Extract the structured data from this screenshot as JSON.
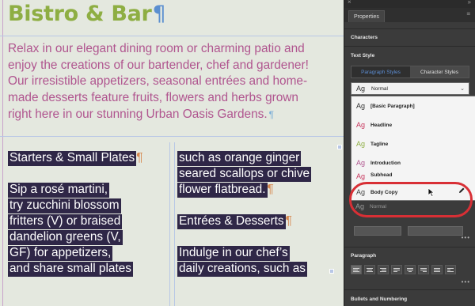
{
  "document": {
    "headline": "Bistro & Bar",
    "intro_lines": [
      "Relax in our elegant dining room or charming patio and",
      "enjoy the creations of our bartender, chef and gardener!",
      "Our irresistible appetizers, seasonal entrées and home-",
      "made desserts feature fruits, flowers and herbs grown",
      "right here in our stunning Urban Oasis Gardens."
    ],
    "column1": [
      "Starters & Small Plates",
      "",
      "Sip a rosé martini,",
      "try zucchini blossom",
      "fritters (V) or braised",
      "dandelion greens (V,",
      "GF) for appetizers,",
      "and share small plates"
    ],
    "column2": [
      "such as orange ginger",
      "seared scallops or chive",
      "flower flatbread.",
      "",
      "Entrées & Desserts",
      "",
      "Indulge in our chef’s",
      "daily creations, such as"
    ],
    "pilcrow": "¶"
  },
  "panel": {
    "close": "×",
    "collapse": "»",
    "tab": "Properties",
    "menu": "≡",
    "sections": {
      "characters": "Characters",
      "text_style": "Text Style",
      "paragraph": "Paragraph",
      "bullets": "Bullets and Numbering"
    },
    "style_tabs": [
      "Paragraph Styles",
      "Character Styles"
    ],
    "selected_style": {
      "ag": "Ag",
      "name": "Normal"
    },
    "chevron": "⌄",
    "style_list": [
      {
        "ag": "Ag",
        "name": "[Basic Paragraph]",
        "color": "#333333"
      },
      {
        "ag": "Ag",
        "name": "Headline",
        "color": "#c8375e"
      },
      {
        "ag": "Ag",
        "name": "Tagline",
        "color": "#8eae43"
      },
      {
        "ag": "Ag",
        "name": "Introduction",
        "color": "#b0558f"
      },
      {
        "ag": "Ag",
        "name": "Subhead",
        "color": "#c8375e"
      },
      {
        "ag": "Ag",
        "name": "Body Copy",
        "color": "#444444"
      },
      {
        "ag": "Ag",
        "name": "Normal",
        "color": "#444444"
      }
    ],
    "more": "•••",
    "callout_color": "#d82f35"
  }
}
